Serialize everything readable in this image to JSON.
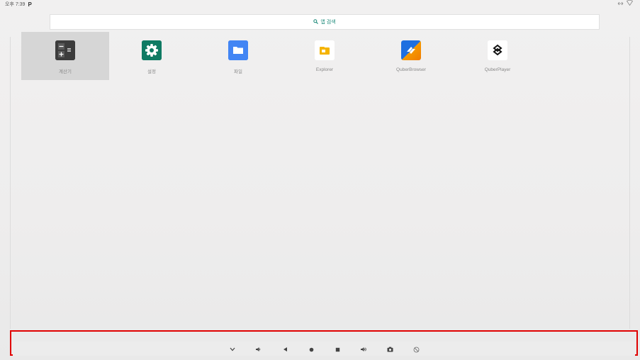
{
  "status": {
    "time": "오후 7:39",
    "notification_icon": "P",
    "right_icons": [
      "data-sync-icon",
      "wifi-icon"
    ]
  },
  "search": {
    "label": "앱 검색"
  },
  "apps": [
    {
      "label": "계산기",
      "icon": "calculator-icon",
      "selected": true
    },
    {
      "label": "설정",
      "icon": "settings-gear-icon"
    },
    {
      "label": "파일",
      "icon": "folder-icon"
    },
    {
      "label": "Explorer",
      "icon": "explorer-icon"
    },
    {
      "label": "QuberBrowser",
      "icon": "quberbrowser-icon"
    },
    {
      "label": "QuberPlayer",
      "icon": "quberplayer-icon"
    }
  ],
  "navbar": {
    "buttons": [
      "collapse-chevron",
      "volume-down",
      "back",
      "home",
      "recents",
      "volume-up",
      "screenshot",
      "rotate"
    ]
  }
}
